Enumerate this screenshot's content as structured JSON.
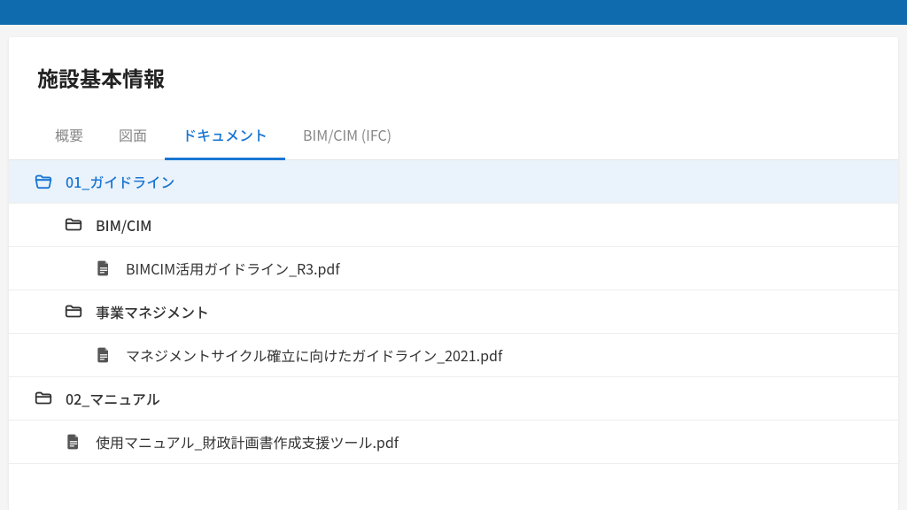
{
  "header": {
    "title": "施設基本情報"
  },
  "tabs": [
    {
      "label": "概要",
      "active": false
    },
    {
      "label": "図面",
      "active": false
    },
    {
      "label": "ドキュメント",
      "active": true
    },
    {
      "label": "BIM/CIM (IFC)",
      "active": false
    }
  ],
  "tree": {
    "items": [
      {
        "type": "folder",
        "label": "01_ガイドライン",
        "level": 0,
        "open": true,
        "selected": true
      },
      {
        "type": "folder",
        "label": "BIM/CIM",
        "level": 1,
        "open": false,
        "selected": false
      },
      {
        "type": "file",
        "label": "BIMCIM活用ガイドライン_R3.pdf",
        "level": 2,
        "selected": false
      },
      {
        "type": "folder",
        "label": "事業マネジメント",
        "level": 1,
        "open": false,
        "selected": false
      },
      {
        "type": "file",
        "label": "マネジメントサイクル確立に向けたガイドライン_2021.pdf",
        "level": 2,
        "selected": false
      },
      {
        "type": "folder",
        "label": "02_マニュアル",
        "level": 0,
        "open": false,
        "selected": false
      },
      {
        "type": "file",
        "label": "使用マニュアル_財政計画書作成支援ツール.pdf",
        "level": 1,
        "selected": false
      }
    ]
  },
  "colors": {
    "brand": "#0f6bad",
    "accent": "#1976d2",
    "selected_bg": "#eaf3fb"
  }
}
